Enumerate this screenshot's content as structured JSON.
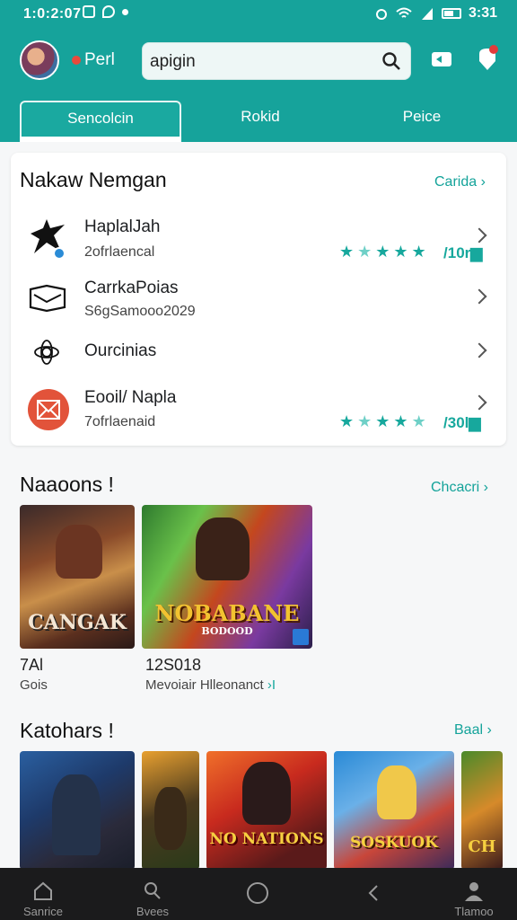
{
  "status_bar": {
    "time": "1:0:2:07",
    "clock": "3:31"
  },
  "header": {
    "app_name": "Perl",
    "search_value": "apigin",
    "tabs": [
      "Sencolcin",
      "Rokid",
      "Peice"
    ]
  },
  "section1": {
    "title": "Nakaw Nemgan",
    "link": "Carida",
    "items": [
      {
        "title": "HaplalJah",
        "subtitle": "2ofrlaencal",
        "rating": "10r",
        "stars": 5,
        "icon": "ninja-icon"
      },
      {
        "title": "CarrkaPoias",
        "subtitle": "S6gSamooo2029",
        "icon": "book-icon"
      },
      {
        "title": "Ourcinias",
        "icon": "gear-atom-icon"
      },
      {
        "title": "Eooil/ Napla",
        "subtitle": "7ofrlaenaid",
        "rating": "30l",
        "stars": 5,
        "icon": "mail-badge-icon"
      }
    ]
  },
  "section2": {
    "title": "Naaoons",
    "link": "Chcacri",
    "games": [
      {
        "art_title": "CANGAK",
        "name": "7Al",
        "sub": "Gois"
      },
      {
        "art_title": "NOBABANE",
        "art_sub": "BODOOD",
        "name": "12S018",
        "sub": "Mevoiair Hlleonanct"
      }
    ]
  },
  "section3": {
    "title": "Katohars",
    "link": "Baal",
    "thumbs": [
      {
        "art_title": ""
      },
      {
        "art_title": ""
      },
      {
        "art_title": "NO NATIONS"
      },
      {
        "art_title": "SOSKUOK"
      },
      {
        "art_title": "CH"
      }
    ]
  },
  "bottom_nav": [
    "Sanrice",
    "Bvees",
    "",
    "",
    "Tlamoo"
  ],
  "colors": {
    "primary": "#16a39b",
    "accent_star": "#17a89d",
    "nav_bg": "#1b1b1c"
  }
}
